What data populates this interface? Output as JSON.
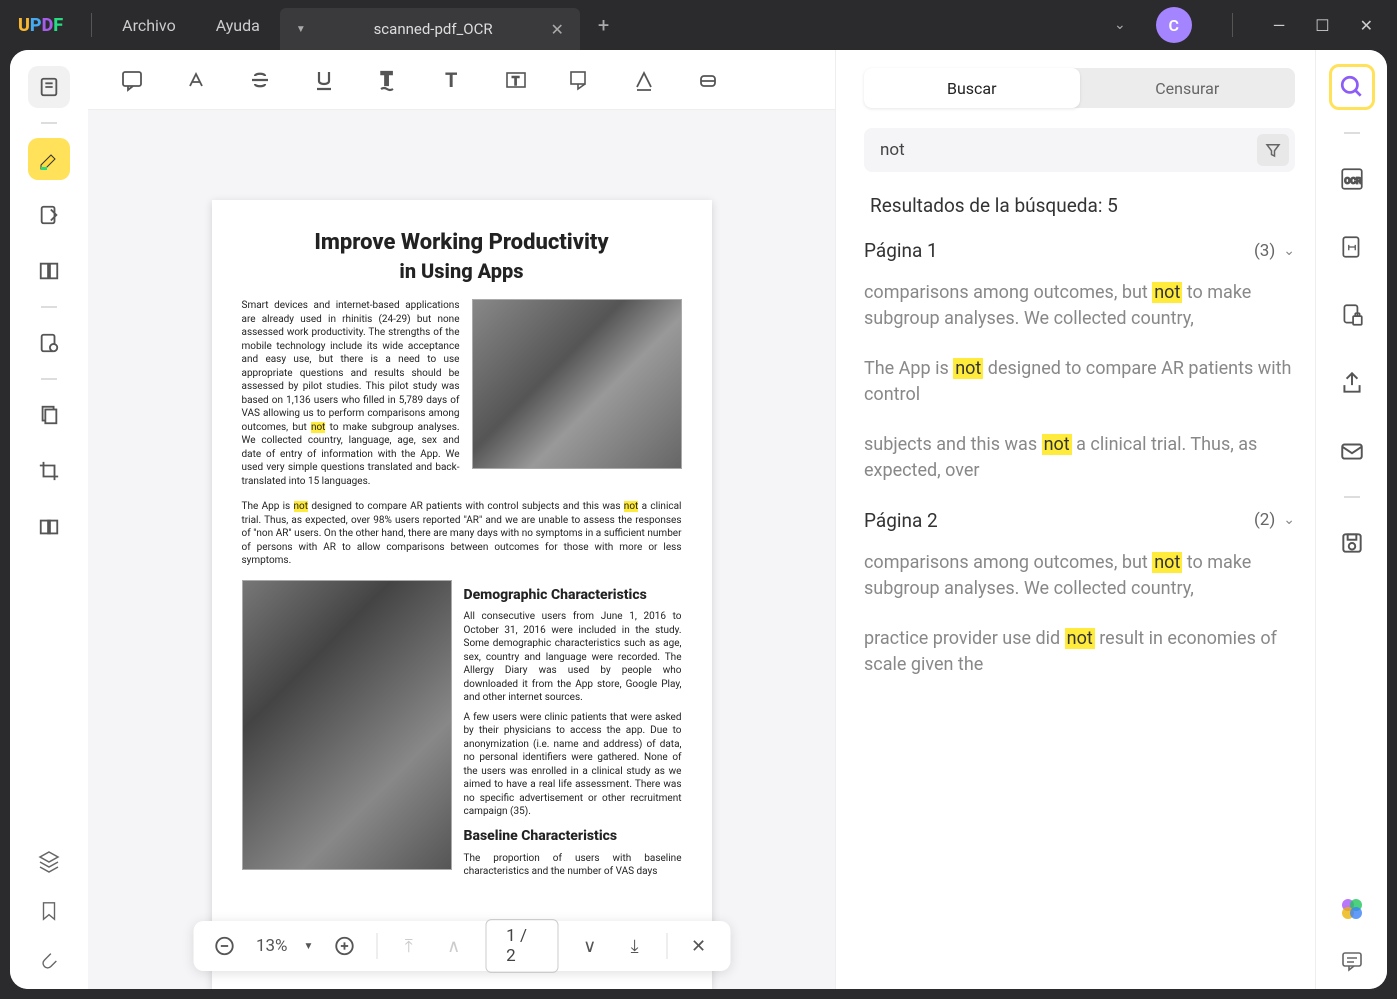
{
  "titlebar": {
    "menu_file": "Archivo",
    "menu_help": "Ayuda",
    "tab_title": "scanned-pdf_OCR",
    "avatar": "C"
  },
  "document": {
    "title1": "Improve Working Productivity",
    "title2": "in Using Apps",
    "para1_a": "Smart devices and internet-based applications are already used in rhinitis (24-29) but none assessed work productivity. The strengths of the mobile technology include its wide acceptance and easy use, but there is a need to use appropriate questions and results should be assessed by pilot studies. This pilot study was based on 1,136 users who filled in 5,789 days of VAS allowing us to perform comparisons among outcomes, but ",
    "para1_hl": "not",
    "para1_b": " to make subgroup analyses. We collected country, language, age, sex and date of entry of information with the App. We used very simple questions translated and back-translated into 15 languages.",
    "para2_a": "The App is ",
    "para2_hl1": "not",
    "para2_b": " designed to compare AR patients with control subjects and this was ",
    "para2_hl2": "not",
    "para2_c": " a clinical trial. Thus, as expected, over 98% users reported \"AR\" and we are unable to assess the responses of \"non AR\" users. On the other hand, there are many days with no symptoms in a sufficient number of persons with AR to allow comparisons between outcomes for those with more or less symptoms.",
    "h3_demo": "Demographic Characteristics",
    "para3": "All consecutive users from June 1, 2016 to October 31, 2016 were included in the study. Some demographic characteristics such as age, sex, country and language were recorded. The Allergy Diary was used by people who downloaded it from the App store, Google Play, and other internet sources.",
    "para4": "A few users were clinic patients that were asked by their physicians to access the app. Due to anonymization (i.e. name and address) of data, no personal identifiers were gathered. None of the users was enrolled in a clinical study as we aimed to have a real life assessment. There was no specific advertisement or other    recruitment campaign (35).",
    "h3_base": "Baseline Characteristics",
    "para5": "The proportion of users with baseline characteristics and the number of VAS days"
  },
  "pagenav": {
    "zoom": "13%",
    "page": "1  /  2"
  },
  "search": {
    "tab_search": "Buscar",
    "tab_redact": "Censurar",
    "query": "not",
    "results_label": "Resultados de la búsqueda: 5",
    "groups": [
      {
        "title": "Página 1",
        "count": "(3)",
        "items": [
          {
            "pre": "comparisons among outcomes, but ",
            "hl": "not",
            "post": " to make subgroup analyses. We collected country,"
          },
          {
            "pre": "The App is ",
            "hl": "not",
            "post": " designed to compare AR patients with control"
          },
          {
            "pre": "subjects and this was ",
            "hl": "not",
            "post": " a clinical trial. Thus, as expected, over"
          }
        ]
      },
      {
        "title": "Página 2",
        "count": "(2)",
        "items": [
          {
            "pre": "comparisons among outcomes, but ",
            "hl": "not",
            "post": " to make subgroup analyses. We collected country,"
          },
          {
            "pre": "practice provider use did ",
            "hl": "not",
            "post": " result in economies of scale given the"
          }
        ]
      }
    ]
  }
}
